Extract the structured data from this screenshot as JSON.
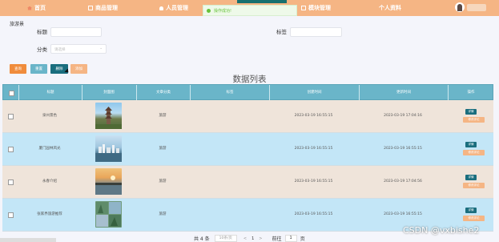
{
  "nav": {
    "items": [
      {
        "label": "首页",
        "active": true
      },
      {
        "label": "商品管理"
      },
      {
        "label": "人员管理"
      },
      {
        "label": "模块管理"
      },
      {
        "label": "个人资料"
      }
    ]
  },
  "toast": {
    "text": "操作成功!"
  },
  "crumb": "旅游景",
  "search": {
    "title_label": "标题",
    "tag_label": "标签",
    "category_label": "分类",
    "category_placeholder": "请选择"
  },
  "buttons": {
    "b1": "查询",
    "b2": "重置",
    "b3": "删除",
    "b4": "添加"
  },
  "table": {
    "heading": "数据列表",
    "columns": [
      "标题",
      "封面图",
      "文章分类",
      "标签",
      "创建时间",
      "更新时间",
      "操作"
    ],
    "rows": [
      {
        "title": "泉州景色",
        "category": "旅游",
        "tag": "",
        "created": "2023-03-19 16:55:15",
        "updated": "2023-03-19 17:04:16",
        "img": "pagoda"
      },
      {
        "title": "厦门园林风光",
        "category": "旅游",
        "tag": "",
        "created": "2023-03-19 16:55:15",
        "updated": "2023-03-19 16:55:15",
        "img": "harbor"
      },
      {
        "title": "永春介绍",
        "category": "旅游",
        "tag": "",
        "created": "2023-03-19 16:55:15",
        "updated": "2023-03-19 17:04:56",
        "img": "sunset"
      },
      {
        "title": "张家界旅游推荐",
        "category": "旅游",
        "tag": "",
        "created": "2023-03-19 16:55:15",
        "updated": "2023-03-19 16:55:15",
        "img": "mosaic"
      }
    ],
    "op_detail": "详情",
    "op_edit": "修改评论"
  },
  "pager": {
    "total": "共 4 条",
    "page_size": "10条/页",
    "prev": "<",
    "page": "1",
    "next": ">",
    "goto": "前往",
    "goto_page": "1",
    "suffix": "页"
  },
  "watermark": "CSDN @vxbishe2",
  "colors": {
    "nav": "#f5b584",
    "header": "#6ab5c9",
    "row_odd": "#efe4da",
    "row_even": "#c3e6f7",
    "btn_orange": "#f08c3c",
    "btn_teal": "#6ab5c9",
    "btn_dark": "#1a6e7e",
    "btn_peach": "#f5b584"
  }
}
